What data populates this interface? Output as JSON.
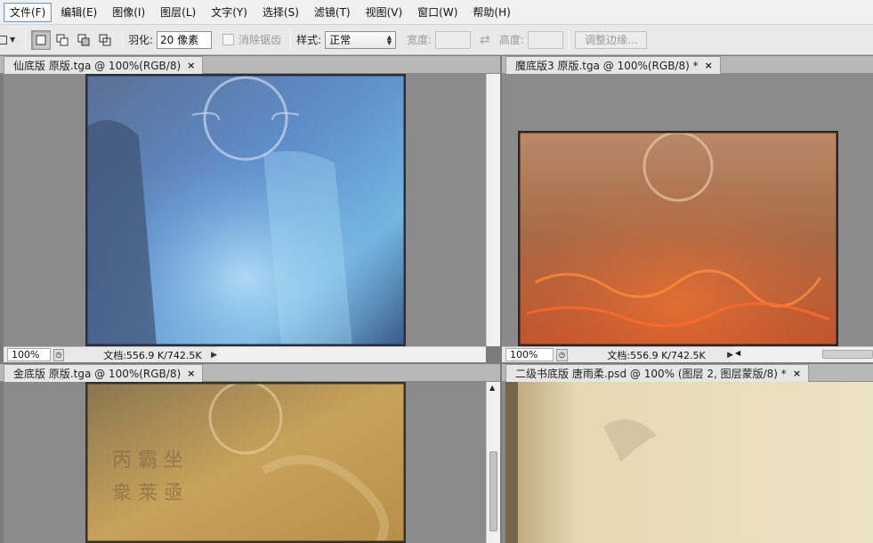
{
  "menubar": {
    "items": [
      {
        "label": "文件(F)",
        "name": "file"
      },
      {
        "label": "编辑(E)",
        "name": "edit"
      },
      {
        "label": "图像(I)",
        "name": "image"
      },
      {
        "label": "图层(L)",
        "name": "layer"
      },
      {
        "label": "文字(Y)",
        "name": "type"
      },
      {
        "label": "选择(S)",
        "name": "select"
      },
      {
        "label": "滤镜(T)",
        "name": "filter"
      },
      {
        "label": "视图(V)",
        "name": "view"
      },
      {
        "label": "窗口(W)",
        "name": "window"
      },
      {
        "label": "帮助(H)",
        "name": "help"
      }
    ],
    "active_index": 0
  },
  "options": {
    "feather_label": "羽化:",
    "feather_value": "20 像素",
    "antialias_label": "消除锯齿",
    "style_label": "样式:",
    "style_value": "正常",
    "width_label": "宽度:",
    "height_label": "高度:",
    "refine_edge_label": "调整边缘...",
    "swap_icon": "swap-icon"
  },
  "documents": [
    {
      "tab": "仙底版 原版.tga @ 100%(RGB/8)",
      "zoom": "100%",
      "docinfo": "文档:556.9 K/742.5K",
      "accent": "#5f8ecb"
    },
    {
      "tab": "魔底版3 原版.tga @ 100%(RGB/8) *",
      "zoom": "100%",
      "docinfo": "文档:556.9 K/742.5K",
      "accent": "#d2643a"
    },
    {
      "tab": "金底版 原版.tga @ 100%(RGB/8)",
      "accent": "#c9a25a"
    },
    {
      "tab": "二级书底版 唐雨柔.psd @ 100% (图层 2, 图层蒙版/8) *",
      "accent": "#e6d9b3"
    }
  ]
}
